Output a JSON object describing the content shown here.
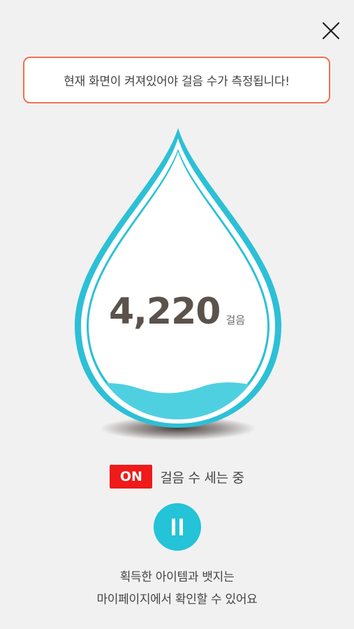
{
  "notice": {
    "text": "현재 화면이 켜져있어야 걸음 수가 측정됩니다!"
  },
  "steps": {
    "count": "4,220",
    "unit": "걸음"
  },
  "status": {
    "badge": "ON",
    "text": "걸음 수 세는 중"
  },
  "info": {
    "line1": "획득한 아이템과 뱃지는",
    "line2": "마이페이지에서 확인할 수 있어요"
  },
  "icons": {
    "close": "close-icon",
    "pause": "pause-icon",
    "drop": "water-drop-icon"
  },
  "colors": {
    "accent": "#24c3d8",
    "notice_border": "#f0724f",
    "on_badge": "#ef1a1a",
    "step_number": "#5b524c",
    "background": "#f1f1f1"
  }
}
